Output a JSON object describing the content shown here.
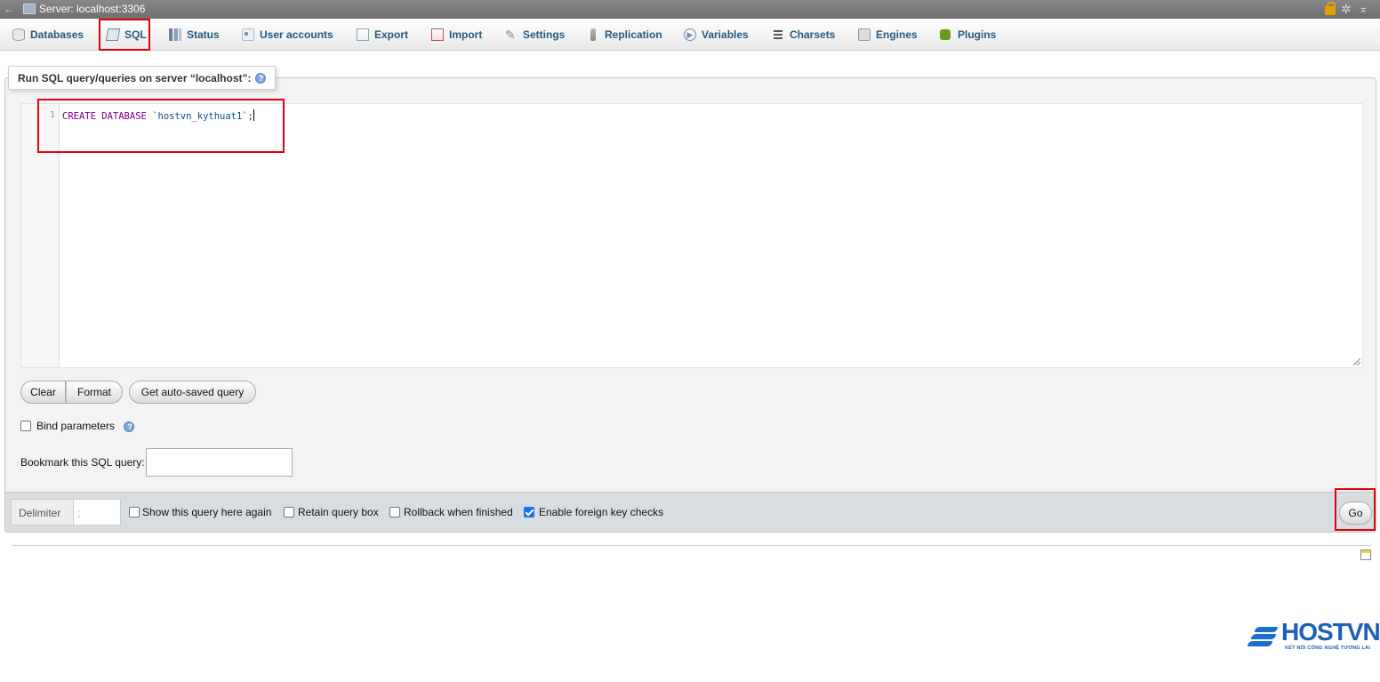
{
  "server_bar": {
    "label": "Server: localhost:3306",
    "collapse_glyph": "←",
    "icons": [
      "lock-icon",
      "gear-icon",
      "collapse-up-icon"
    ]
  },
  "tabs": [
    {
      "label": "Databases",
      "icon": "database-icon"
    },
    {
      "label": "SQL",
      "icon": "sql-icon"
    },
    {
      "label": "Status",
      "icon": "status-icon"
    },
    {
      "label": "User accounts",
      "icon": "user-accounts-icon"
    },
    {
      "label": "Export",
      "icon": "export-icon"
    },
    {
      "label": "Import",
      "icon": "import-icon"
    },
    {
      "label": "Settings",
      "icon": "wrench-icon"
    },
    {
      "label": "Replication",
      "icon": "replication-icon"
    },
    {
      "label": "Variables",
      "icon": "variables-icon"
    },
    {
      "label": "Charsets",
      "icon": "charsets-icon"
    },
    {
      "label": "Engines",
      "icon": "engines-icon"
    },
    {
      "label": "Plugins",
      "icon": "puzzle-icon"
    }
  ],
  "active_tab": "SQL",
  "panel": {
    "legend": "Run SQL query/queries on server “localhost”:",
    "editor": {
      "line_number": "1",
      "kw1": "CREATE",
      "kw2": "DATABASE",
      "db_name": "`hostvn_kythuat1`",
      "terminator": ";"
    },
    "buttons": {
      "clear": "Clear",
      "format": "Format",
      "auto_saved": "Get auto-saved query"
    },
    "bind_parameters": {
      "label": "Bind parameters",
      "checked": false
    },
    "bookmark": {
      "label": "Bookmark this SQL query:",
      "value": ""
    }
  },
  "bottom": {
    "delimiter_label": "Delimiter",
    "delimiter_value": ";",
    "options": [
      {
        "label": "Show this query here again",
        "checked": false
      },
      {
        "label": "Retain query box",
        "checked": false
      },
      {
        "label": "Rollback when finished",
        "checked": false
      },
      {
        "label": "Enable foreign key checks",
        "checked": true
      }
    ],
    "go_label": "Go"
  },
  "logo": {
    "text": "HOSTVN",
    "tagline": "KẾT NỐI CÔNG NGHỆ TƯƠNG LAI"
  },
  "colors": {
    "highlight": "#e4000f",
    "link": "#235a81",
    "logo": "#1a5fb8",
    "checkbox_checked": "#1a73e8"
  }
}
